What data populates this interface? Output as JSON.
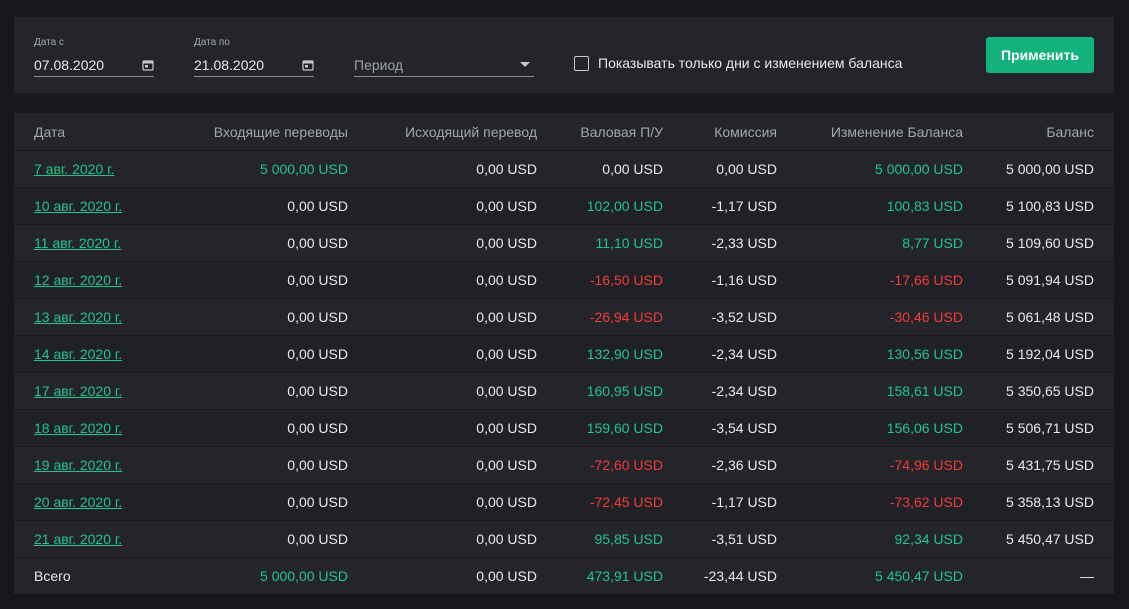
{
  "filters": {
    "date_from_label": "Дата с",
    "date_from_value": "07.08.2020",
    "date_to_label": "Дата по",
    "date_to_value": "21.08.2020",
    "period_placeholder": "Период",
    "checkbox_label": "Показывать только дни с изменением баланса",
    "apply_label": "Применить"
  },
  "table": {
    "headers": [
      "Дата",
      "Входящие переводы",
      "Исходящий перевод",
      "Валовая П/У",
      "Комиссия",
      "Изменение Баланса",
      "Баланс"
    ],
    "rows": [
      {
        "date": "7 авг. 2020 г.",
        "in": "5 000,00 USD",
        "out": "0,00 USD",
        "gross": "0,00 USD",
        "fee": "0,00 USD",
        "change": "5 000,00 USD",
        "balance": "5 000,00 USD",
        "in_c": "pos",
        "gross_c": "neu",
        "change_c": "pos"
      },
      {
        "date": "10 авг. 2020 г.",
        "in": "0,00 USD",
        "out": "0,00 USD",
        "gross": "102,00 USD",
        "fee": "-1,17 USD",
        "change": "100,83 USD",
        "balance": "5 100,83 USD",
        "in_c": "neu",
        "gross_c": "pos",
        "change_c": "pos"
      },
      {
        "date": "11 авг. 2020 г.",
        "in": "0,00 USD",
        "out": "0,00 USD",
        "gross": "11,10 USD",
        "fee": "-2,33 USD",
        "change": "8,77 USD",
        "balance": "5 109,60 USD",
        "in_c": "neu",
        "gross_c": "pos",
        "change_c": "pos"
      },
      {
        "date": "12 авг. 2020 г.",
        "in": "0,00 USD",
        "out": "0,00 USD",
        "gross": "-16,50 USD",
        "fee": "-1,16 USD",
        "change": "-17,66 USD",
        "balance": "5 091,94 USD",
        "in_c": "neu",
        "gross_c": "neg",
        "change_c": "neg"
      },
      {
        "date": "13 авг. 2020 г.",
        "in": "0,00 USD",
        "out": "0,00 USD",
        "gross": "-26,94 USD",
        "fee": "-3,52 USD",
        "change": "-30,46 USD",
        "balance": "5 061,48 USD",
        "in_c": "neu",
        "gross_c": "neg",
        "change_c": "neg"
      },
      {
        "date": "14 авг. 2020 г.",
        "in": "0,00 USD",
        "out": "0,00 USD",
        "gross": "132,90 USD",
        "fee": "-2,34 USD",
        "change": "130,56 USD",
        "balance": "5 192,04 USD",
        "in_c": "neu",
        "gross_c": "pos",
        "change_c": "pos"
      },
      {
        "date": "17 авг. 2020 г.",
        "in": "0,00 USD",
        "out": "0,00 USD",
        "gross": "160,95 USD",
        "fee": "-2,34 USD",
        "change": "158,61 USD",
        "balance": "5 350,65 USD",
        "in_c": "neu",
        "gross_c": "pos",
        "change_c": "pos"
      },
      {
        "date": "18 авг. 2020 г.",
        "in": "0,00 USD",
        "out": "0,00 USD",
        "gross": "159,60 USD",
        "fee": "-3,54 USD",
        "change": "156,06 USD",
        "balance": "5 506,71 USD",
        "in_c": "neu",
        "gross_c": "pos",
        "change_c": "pos"
      },
      {
        "date": "19 авг. 2020 г.",
        "in": "0,00 USD",
        "out": "0,00 USD",
        "gross": "-72,60 USD",
        "fee": "-2,36 USD",
        "change": "-74,96 USD",
        "balance": "5 431,75 USD",
        "in_c": "neu",
        "gross_c": "neg",
        "change_c": "neg"
      },
      {
        "date": "20 авг. 2020 г.",
        "in": "0,00 USD",
        "out": "0,00 USD",
        "gross": "-72,45 USD",
        "fee": "-1,17 USD",
        "change": "-73,62 USD",
        "balance": "5 358,13 USD",
        "in_c": "neu",
        "gross_c": "neg",
        "change_c": "neg"
      },
      {
        "date": "21 авг. 2020 г.",
        "in": "0,00 USD",
        "out": "0,00 USD",
        "gross": "95,85 USD",
        "fee": "-3,51 USD",
        "change": "92,34 USD",
        "balance": "5 450,47 USD",
        "in_c": "neu",
        "gross_c": "pos",
        "change_c": "pos"
      }
    ],
    "total": {
      "label": "Всего",
      "in": "5 000,00 USD",
      "out": "0,00 USD",
      "gross": "473,91 USD",
      "fee": "-23,44 USD",
      "change": "5 450,47 USD",
      "balance": "—"
    }
  },
  "colors": {
    "accent": "#12b27a",
    "positive": "#1ec68a",
    "negative": "#f23a3a",
    "background": "#17181c",
    "panel": "#23252b"
  }
}
